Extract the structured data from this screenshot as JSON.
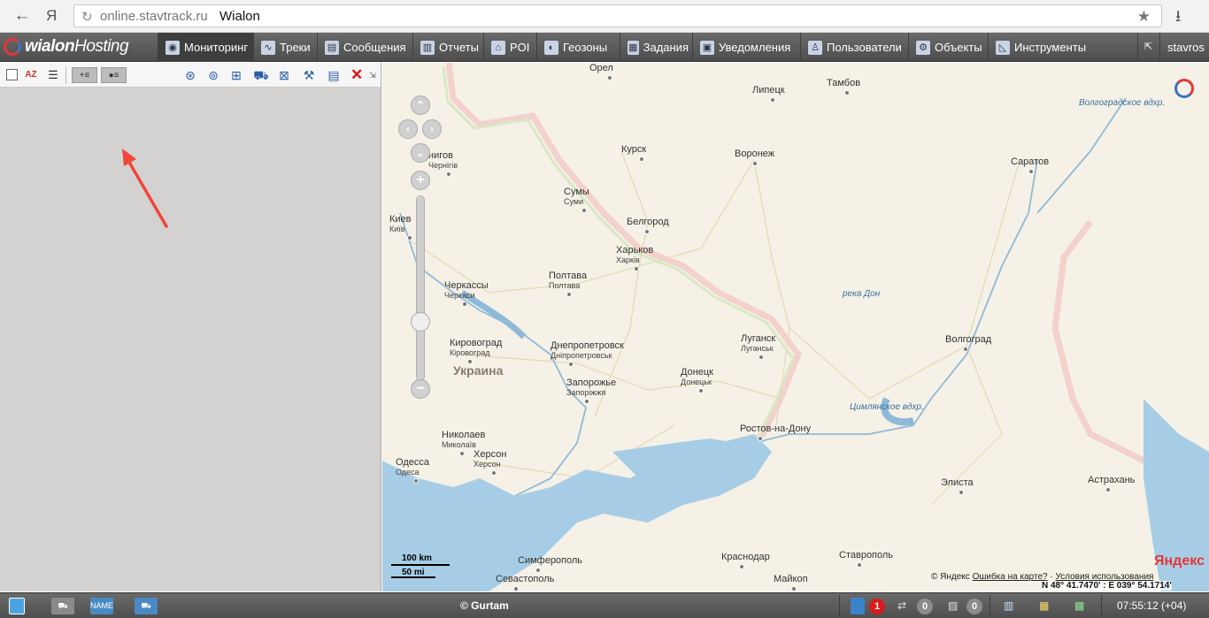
{
  "browser": {
    "back_label": "←",
    "ya_label": "Я",
    "url": "online.stavtrack.ru",
    "page_title": "Wialon",
    "star": "★",
    "download": "⭳"
  },
  "app": {
    "logo_text_a": "wialon",
    "logo_text_b": "Hosting",
    "user": "stavros",
    "nav": [
      {
        "label": "Мониторинг",
        "icon": "globe-icon",
        "glyph": "◉"
      },
      {
        "label": "Треки",
        "icon": "track-icon",
        "glyph": "∿"
      },
      {
        "label": "Сообщения",
        "icon": "messages-icon",
        "glyph": "▤"
      },
      {
        "label": "Отчеты",
        "icon": "reports-icon",
        "glyph": "▥"
      },
      {
        "label": "POI",
        "icon": "poi-icon",
        "glyph": "⌂"
      },
      {
        "label": "Геозоны",
        "icon": "geofence-icon",
        "glyph": "◐"
      },
      {
        "label": "Задания",
        "icon": "tasks-icon",
        "glyph": "▦"
      },
      {
        "label": "Уведомления",
        "icon": "notifications-icon",
        "glyph": "▣"
      },
      {
        "label": "Пользователи",
        "icon": "users-icon",
        "glyph": "♙"
      },
      {
        "label": "Объекты",
        "icon": "objects-icon",
        "glyph": "⚙"
      },
      {
        "label": "Инструменты",
        "icon": "tools-icon",
        "glyph": "◺"
      }
    ],
    "collapse_glyph": "⇱"
  },
  "panel_toolbar": {
    "sort_label": "AZ",
    "list_glyph": "☰",
    "add_glyph": "+≡",
    "dot_glyph": "●≡",
    "right_tools": [
      {
        "name": "locate-icon",
        "glyph": "⊛"
      },
      {
        "name": "satellite-icon",
        "glyph": "⊚"
      },
      {
        "name": "network-icon",
        "glyph": "⊞"
      },
      {
        "name": "truck-tool-icon",
        "glyph": "⛟"
      },
      {
        "name": "map-tool-icon",
        "glyph": "⊠"
      },
      {
        "name": "wrench-icon",
        "glyph": "⚒"
      },
      {
        "name": "list-tool-icon",
        "glyph": "▤"
      }
    ],
    "close_glyph": "✕",
    "corner_glyph": "⇲"
  },
  "map": {
    "country": "Украина",
    "cities": [
      {
        "name": "Орел",
        "sub": ""
      },
      {
        "name": "Тамбов",
        "sub": ""
      },
      {
        "name": "Липецк",
        "sub": ""
      },
      {
        "name": "Курск",
        "sub": ""
      },
      {
        "name": "Воронеж",
        "sub": ""
      },
      {
        "name": "Саратов",
        "sub": ""
      },
      {
        "name": "нигов",
        "sub": "Чернігів"
      },
      {
        "name": "Сумы",
        "sub": "Суми"
      },
      {
        "name": "Белгород",
        "sub": ""
      },
      {
        "name": "Киев",
        "sub": "Київ"
      },
      {
        "name": "Харьков",
        "sub": "Харків"
      },
      {
        "name": "Полтава",
        "sub": "Полтава"
      },
      {
        "name": "Черкассы",
        "sub": "Черкаси"
      },
      {
        "name": "Луганск",
        "sub": "Луганськ"
      },
      {
        "name": "Кировоград",
        "sub": "Кіровоград"
      },
      {
        "name": "Днепропетровск",
        "sub": "Дніпропетровськ"
      },
      {
        "name": "Волгоград",
        "sub": ""
      },
      {
        "name": "Донецк",
        "sub": "Донецьк"
      },
      {
        "name": "Запорожье",
        "sub": "Запоріжжя"
      },
      {
        "name": "Ростов-на-Дону",
        "sub": ""
      },
      {
        "name": "Николаев",
        "sub": "Миколаїв"
      },
      {
        "name": "Херсон",
        "sub": "Херсон"
      },
      {
        "name": "Одесса",
        "sub": "Одеса"
      },
      {
        "name": "Элиста",
        "sub": ""
      },
      {
        "name": "Астрахань",
        "sub": ""
      },
      {
        "name": "Симферополь",
        "sub": ""
      },
      {
        "name": "Краснодар",
        "sub": ""
      },
      {
        "name": "Ставрополь",
        "sub": ""
      },
      {
        "name": "Севастополь",
        "sub": ""
      },
      {
        "name": "Майкоп",
        "sub": ""
      }
    ],
    "water": [
      "Волгоградское вдхр.",
      "река Дон",
      "Цимлянское вдхр."
    ],
    "scale_km": "100 km",
    "scale_mi": "50 mi",
    "copyright_prefix": "© Яндекс",
    "copyright_link1": "Ошибка на карте?",
    "copyright_sep": "·",
    "copyright_link2": "Условия использования",
    "brand": "Яндекс",
    "coords": "N 48° 41.7470' : E 039° 54.1714'",
    "ctrl_up": "⌃",
    "ctrl_left": "‹",
    "ctrl_right": "›",
    "ctrl_down": "⌄",
    "zoom_in": "+",
    "zoom_out": "−"
  },
  "statusbar": {
    "gurtam": "© Gurtam",
    "messages_count": "1",
    "events_count": "0",
    "images_count": "0",
    "time": "07:55:12 (+04)",
    "truck_name_label": "NAME"
  }
}
